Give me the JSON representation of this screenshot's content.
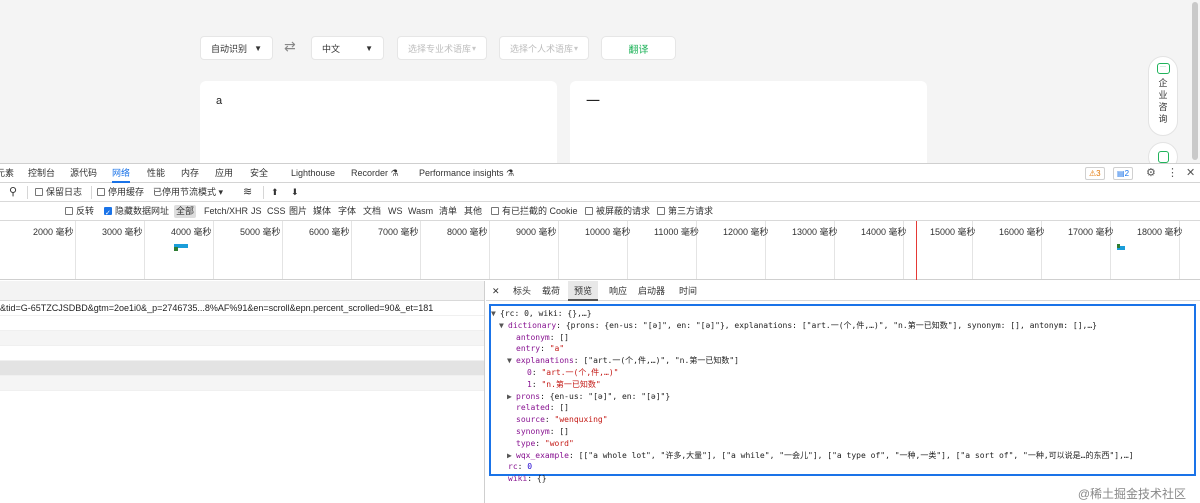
{
  "page": {
    "lang_from": "自动识别",
    "lang_to": "中文",
    "pro_lib": "选择专业术语库",
    "personal_lib": "选择个人术语库",
    "translate_btn": "翻译",
    "source_text": "a",
    "target_text": "一",
    "consult_label": "企业咨询"
  },
  "devtools": {
    "tabs": [
      "元素",
      "控制台",
      "源代码",
      "网络",
      "性能",
      "内存",
      "应用",
      "安全",
      "Lighthouse",
      "Recorder ⚗",
      "Performance insights ⚗"
    ],
    "active_tab": "网络",
    "warnings": "3",
    "messages": "2",
    "toolbar": {
      "preserve_log": "保留日志",
      "disable_cache": "停用缓存",
      "throttle": "已停用节流模式"
    },
    "filter": {
      "invert": "反转",
      "hide_data_urls": "隐藏数据网址",
      "types": [
        "全部",
        "Fetch/XHR",
        "JS",
        "CSS",
        "图片",
        "媒体",
        "字体",
        "文档",
        "WS",
        "Wasm",
        "清单",
        "其他"
      ],
      "blocked_cookies": "有已拦截的 Cookie",
      "blocked_requests": "被屏蔽的请求",
      "third_party": "第三方请求"
    },
    "timeline_ticks": [
      "2000 毫秒",
      "3000 毫秒",
      "4000 毫秒",
      "5000 毫秒",
      "6000 毫秒",
      "7000 毫秒",
      "8000 毫秒",
      "9000 毫秒",
      "10000 毫秒",
      "11000 毫秒",
      "12000 毫秒",
      "13000 毫秒",
      "14000 毫秒",
      "15000 毫秒",
      "16000 毫秒",
      "17000 毫秒",
      "18000 毫秒"
    ],
    "request_row": "&tid=G-65TZCJSDBD&gtm=2oe1i0&_p=2746735...8%AF%91&en=scroll&epn.percent_scrolled=90&_et=181",
    "detail_tabs": [
      "标头",
      "载荷",
      "预览",
      "响应",
      "启动器",
      "时间"
    ],
    "active_detail_tab": "预览",
    "preview_lines": {
      "root": "{rc: 0, wiki: {},…}",
      "dictionary_key": "dictionary",
      "dictionary_summary": "{prons: {en-us: \"[ə]\", en: \"[ə]\"}, explanations: [\"art.一(个,件,…)\", \"n.第一已知数\"], synonym: [], antonym: [],…}",
      "antonym": "[]",
      "entry": "\"a\"",
      "explanations_summary": "[\"art.一(个,件,…)\", \"n.第一已知数\"]",
      "exp0": "\"art.一(个,件,…)\"",
      "exp1": "\"n.第一已知数\"",
      "prons": "{en-us: \"[ə]\", en: \"[ə]\"}",
      "related": "[]",
      "source": "\"wenquxing\"",
      "synonym": "[]",
      "type": "\"word\"",
      "wqx_example": "[[\"a whole lot\", \"许多,大量\"], [\"a while\", \"一会儿\"], [\"a type of\", \"一种,一类\"], [\"a sort of\", \"一种,可以说是…的东西\"],…]",
      "rc": "0",
      "wiki": "{}"
    },
    "watermark": "@稀土掘金技术社区"
  }
}
